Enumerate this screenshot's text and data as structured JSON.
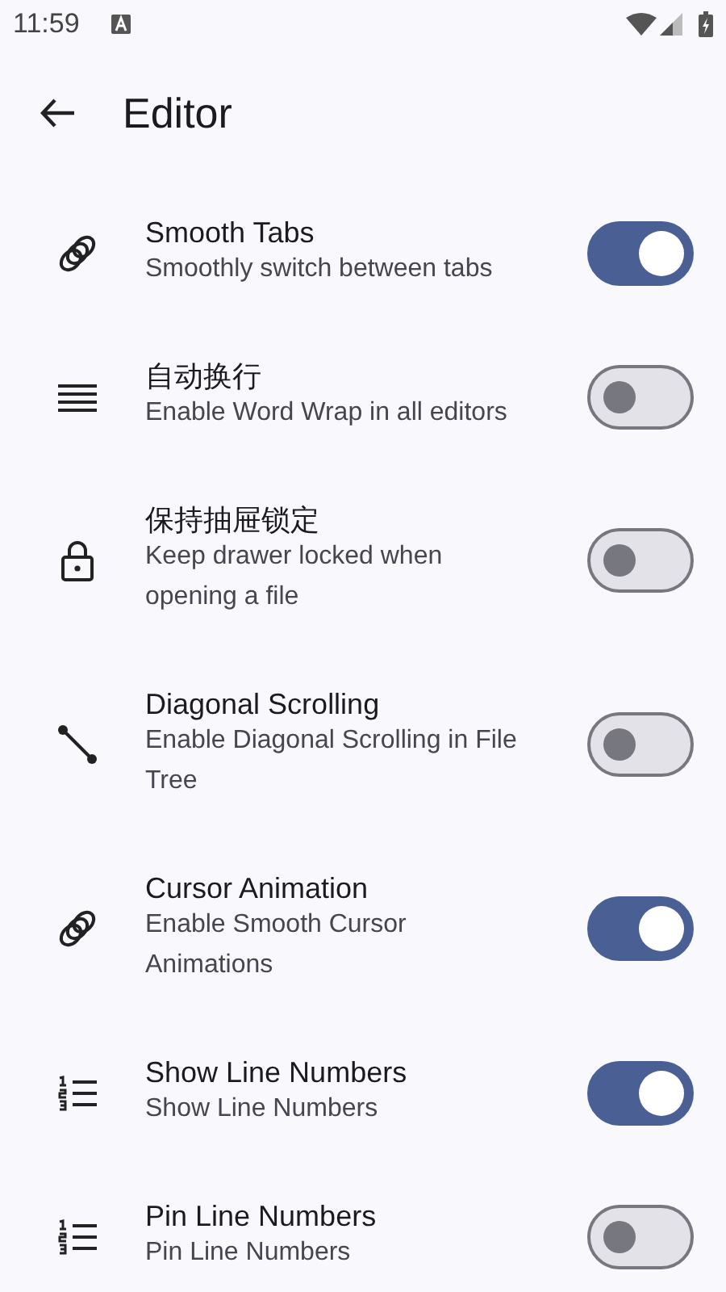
{
  "status_bar": {
    "time": "11:59"
  },
  "app_bar": {
    "title": "Editor"
  },
  "settings": [
    {
      "title": "Smooth Tabs",
      "subtitle": "Smoothly switch between tabs",
      "on": true
    },
    {
      "title": "自动换行",
      "subtitle": "Enable Word Wrap in all editors",
      "on": false
    },
    {
      "title": "保持抽屉锁定",
      "subtitle": "Keep drawer locked when opening a file",
      "on": false
    },
    {
      "title": "Diagonal Scrolling",
      "subtitle": "Enable Diagonal Scrolling in File Tree",
      "on": false
    },
    {
      "title": "Cursor Animation",
      "subtitle": "Enable Smooth Cursor Animations",
      "on": true
    },
    {
      "title": "Show Line Numbers",
      "subtitle": "Show Line Numbers",
      "on": true
    },
    {
      "title": "Pin Line Numbers",
      "subtitle": "Pin Line Numbers",
      "on": false
    }
  ]
}
